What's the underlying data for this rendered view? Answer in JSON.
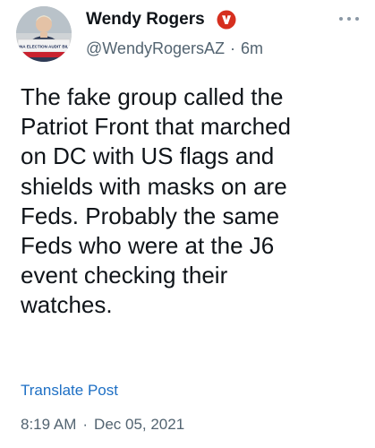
{
  "tweet": {
    "author": {
      "display_name": "Wendy Rogers",
      "handle": "@WendyRogersAZ",
      "verified": true,
      "avatar_caption": "ONA ELECTION AUDIT BILL"
    },
    "relative_time": "6m",
    "separator": "·",
    "body_lines": [
      "The fake group called the",
      "Patriot Front that marched",
      "on DC with US flags and",
      "shields with masks on are",
      "Feds. Probably the same",
      "Feds who were at the J6",
      "event checking their",
      "watches."
    ],
    "translate_label": "Translate Post",
    "time": "8:19 AM",
    "date": "Dec 05, 2021"
  },
  "icons": {
    "verified": "verified-badge-icon",
    "more": "more-options-icon"
  },
  "colors": {
    "link": "#1d6fc4",
    "secondary_text": "#536471",
    "primary_text": "#0f1419",
    "verified_badge": "#d62f1f"
  }
}
